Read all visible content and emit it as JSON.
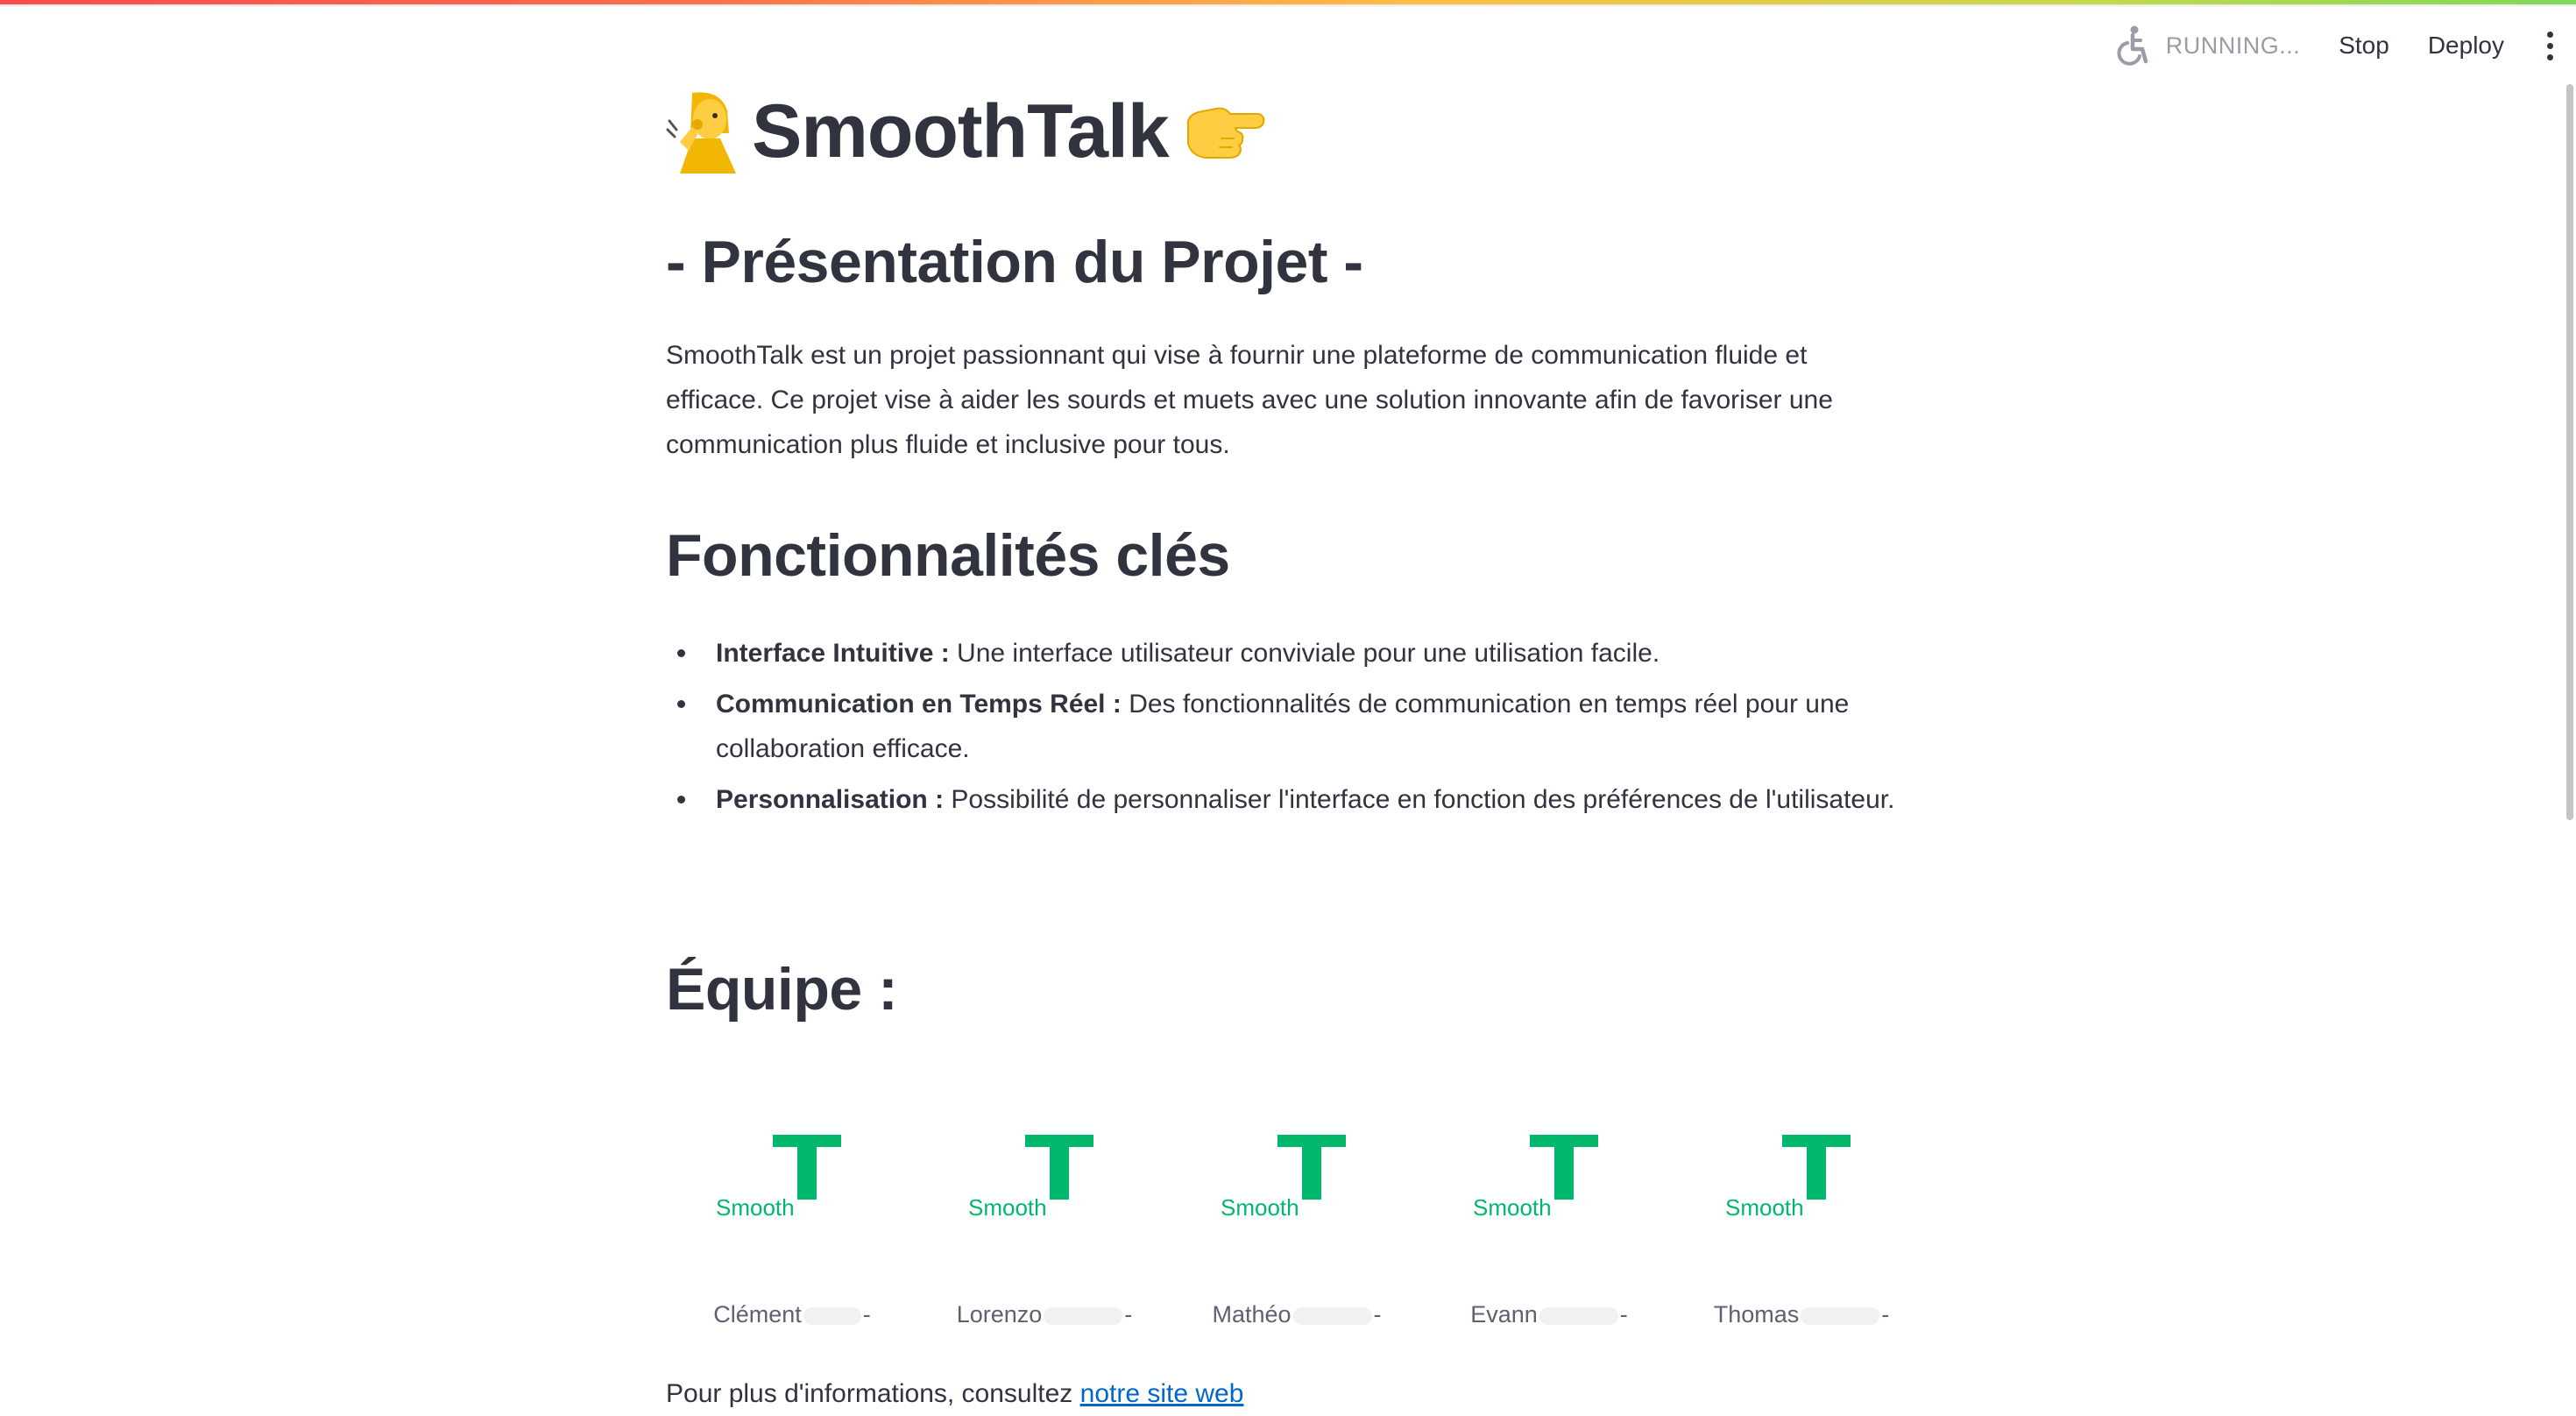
{
  "toolbar": {
    "status_text": "RUNNING...",
    "stop_label": "Stop",
    "deploy_label": "Deploy"
  },
  "title": {
    "text": "SmoothTalk",
    "emoji_left": "deaf-person-emoji",
    "emoji_right": "pointing-hand-emoji"
  },
  "presentation": {
    "heading": "- Présentation du Projet -",
    "text": "SmoothTalk est un projet passionnant qui vise à fournir une plateforme de communication fluide et efficace. Ce projet vise à aider les sourds et muets avec une solution innovante afin de favoriser une communication plus fluide et inclusive pour tous."
  },
  "features": {
    "heading": "Fonctionnalités clés",
    "items": [
      {
        "title": "Interface Intuitive :",
        "text": " Une interface utilisateur conviviale pour une utilisation facile."
      },
      {
        "title": "Communication en Temps Réel :",
        "text": " Des fonctionnalités de communication en temps réel pour une collaboration efficace."
      },
      {
        "title": "Personnalisation :",
        "text": " Possibilité de personnaliser l'interface en fonction des préférences de l'utilisateur."
      }
    ]
  },
  "team": {
    "heading": "Équipe :",
    "logo_word": "Smooth",
    "logo_letter": "T",
    "members": [
      {
        "name": "Clément",
        "suffix": "-"
      },
      {
        "name": "Lorenzo",
        "suffix": "-"
      },
      {
        "name": "Mathéo",
        "suffix": "-"
      },
      {
        "name": "Evann",
        "suffix": "-"
      },
      {
        "name": "Thomas",
        "suffix": "-"
      }
    ]
  },
  "more_info": {
    "text": "Pour plus d'informations, consultez ",
    "link_label": "notre site web"
  },
  "colors": {
    "logo_green": "#00b86b",
    "link_blue": "#0068c9",
    "text": "#31333f"
  }
}
